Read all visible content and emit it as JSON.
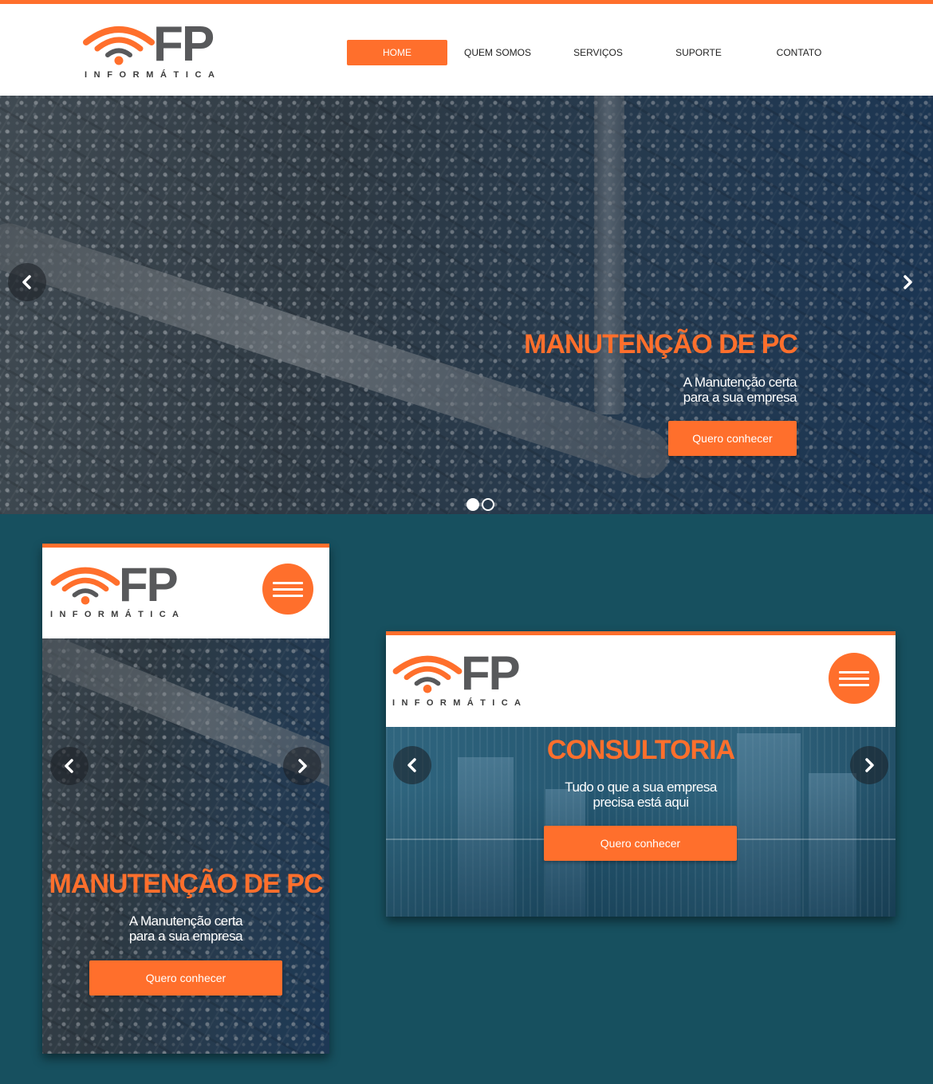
{
  "brand": {
    "name": "FP",
    "tagline": "INFORMÁTICA",
    "accent_color": "#ff6f2c",
    "background_color": "#17505f"
  },
  "nav": {
    "items": [
      {
        "label": "HOME",
        "active": true
      },
      {
        "label": "QUEM SOMOS",
        "active": false
      },
      {
        "label": "SERVIÇOS",
        "active": false
      },
      {
        "label": "SUPORTE",
        "active": false
      },
      {
        "label": "CONTATO",
        "active": false
      }
    ]
  },
  "hero": {
    "title": "MANUTENÇÃO DE PC",
    "subtitle_line1": "A Manutenção certa",
    "subtitle_line2": "para a sua empresa",
    "cta_label": "Quero conhecer",
    "prev_icon": "chevron-left-icon",
    "next_icon": "chevron-right-icon",
    "dots": 2,
    "active_dot": 1
  },
  "mobile_mockup": {
    "title": "MANUTENÇÃO DE PC",
    "subtitle_line1": "A Manutenção certa",
    "subtitle_line2": "para a sua empresa",
    "cta_label": "Quero conhecer",
    "menu_icon": "hamburger-menu-icon"
  },
  "tablet_mockup": {
    "title": "CONSULTORIA",
    "subtitle_line1": "Tudo o que a sua empresa",
    "subtitle_line2": "precisa está aqui",
    "cta_label": "Quero conhecer",
    "menu_icon": "hamburger-menu-icon"
  }
}
